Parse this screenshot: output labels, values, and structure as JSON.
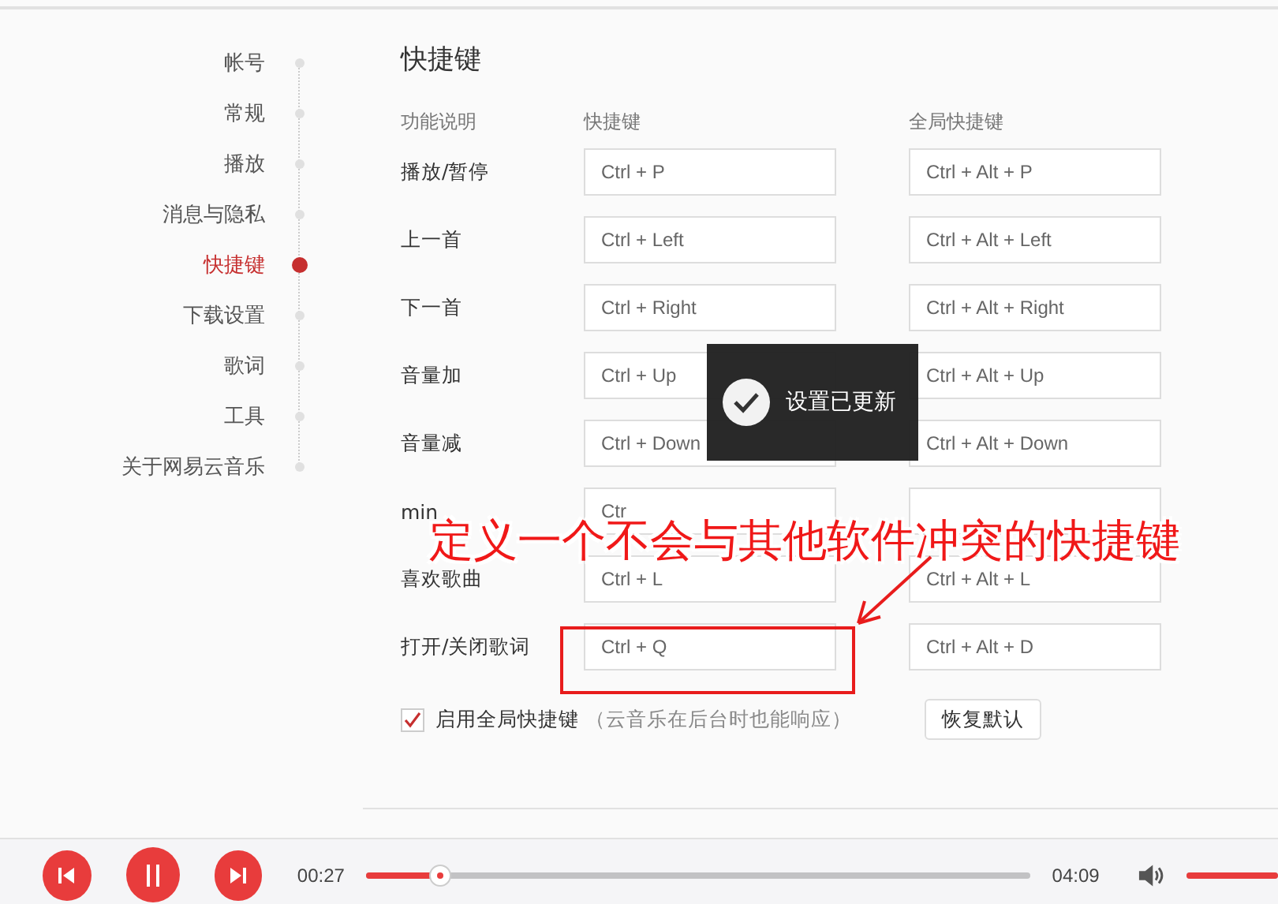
{
  "sidebar": {
    "items": [
      {
        "label": "帐号",
        "selected": false
      },
      {
        "label": "常规",
        "selected": false
      },
      {
        "label": "播放",
        "selected": false
      },
      {
        "label": "消息与隐私",
        "selected": false
      },
      {
        "label": "快捷键",
        "selected": true
      },
      {
        "label": "下载设置",
        "selected": false
      },
      {
        "label": "歌词",
        "selected": false
      },
      {
        "label": "工具",
        "selected": false
      },
      {
        "label": "关于网易云音乐",
        "selected": false
      }
    ]
  },
  "section": {
    "title": "快捷键",
    "columns": [
      "功能说明",
      "快捷键",
      "全局快捷键"
    ],
    "rows": [
      {
        "label": "播放/暂停",
        "hotkey": "Ctrl + P",
        "global": "Ctrl + Alt + P"
      },
      {
        "label": "上一首",
        "hotkey": "Ctrl + Left",
        "global": "Ctrl + Alt + Left"
      },
      {
        "label": "下一首",
        "hotkey": "Ctrl + Right",
        "global": "Ctrl + Alt + Right"
      },
      {
        "label": "音量加",
        "hotkey": "Ctrl + Up",
        "global": "Ctrl + Alt + Up"
      },
      {
        "label": "音量减",
        "hotkey": "Ctrl + Down",
        "global": "Ctrl + Alt + Down"
      },
      {
        "label": "min",
        "hotkey": "Ctr"
      },
      {
        "label": "喜欢歌曲",
        "hotkey": "Ctrl + L",
        "global": "Ctrl + Alt + L"
      },
      {
        "label": "打开/关闭歌词",
        "hotkey": "Ctrl + Q",
        "global": "Ctrl + Alt + D"
      }
    ],
    "enable_global": {
      "label": "启用全局快捷键",
      "note": "（云音乐在后台时也能响应）",
      "checked": true
    },
    "reset_button": "恢复默认"
  },
  "toast": {
    "text": "设置已更新"
  },
  "annotation": {
    "text": "定义一个不会与其他软件冲突的快捷键"
  },
  "player": {
    "elapsed": "00:27",
    "total": "04:09",
    "progress": {
      "level": 0.11
    },
    "volume": {
      "level": 1
    }
  }
}
